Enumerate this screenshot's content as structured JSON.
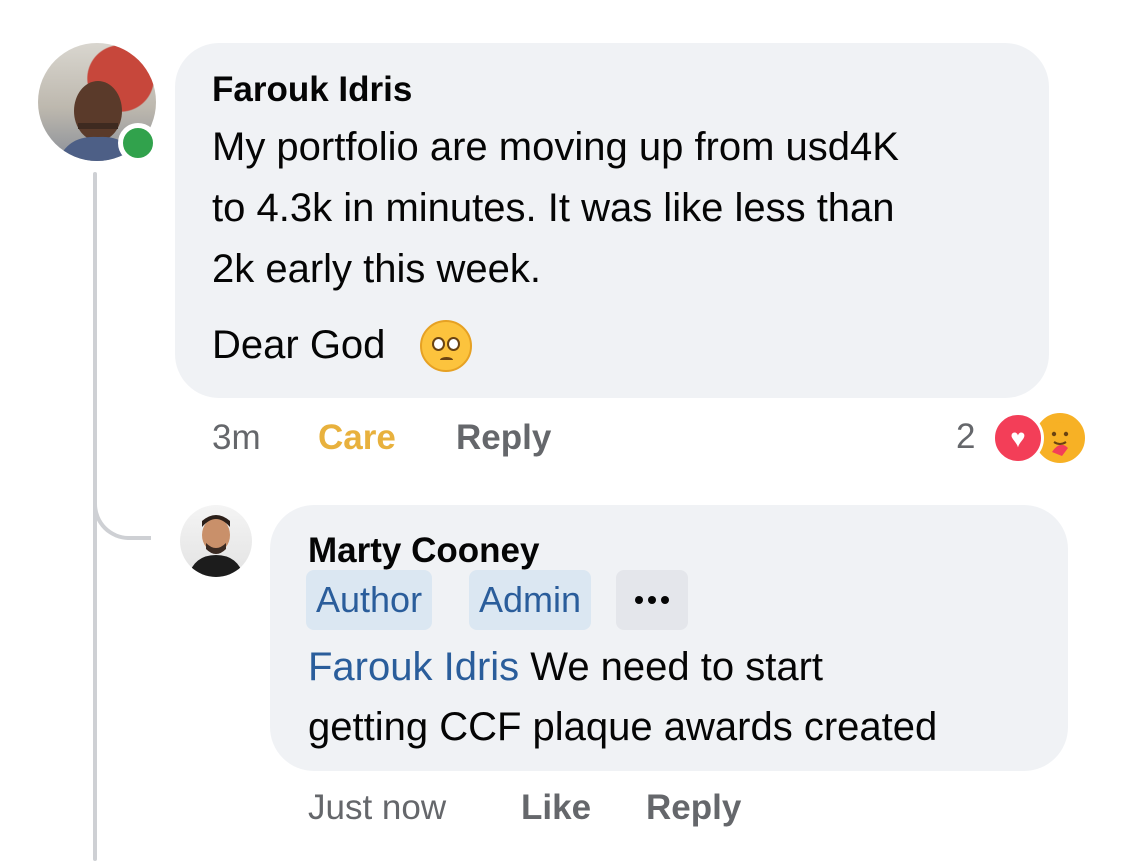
{
  "comment": {
    "author": "Farouk Idris",
    "body_lines": [
      "My portfolio are moving up from usd4K",
      "to 4.3k in minutes. It was like less than",
      "2k early this week."
    ],
    "closing_text": "Dear God",
    "closing_emoji": "pleading-face-emoji",
    "time": "3m",
    "reaction_label": "Care",
    "reply_label": "Reply",
    "reaction_count": "2",
    "reaction_icons": [
      "love-icon",
      "care-icon"
    ],
    "online": true
  },
  "reply": {
    "author": "Marty Cooney",
    "badges": [
      "Author",
      "Admin"
    ],
    "mention": "Farouk Idris",
    "body_line_1": " We need to start",
    "body_line_2": "getting CCF plaque awards created",
    "time": "Just now",
    "like_label": "Like",
    "reply_label": "Reply"
  },
  "colors": {
    "bubble": "#f0f2f5",
    "care": "#e8b13d",
    "link": "#2a5d9b",
    "online": "#31a24c",
    "love": "#f33e58"
  }
}
